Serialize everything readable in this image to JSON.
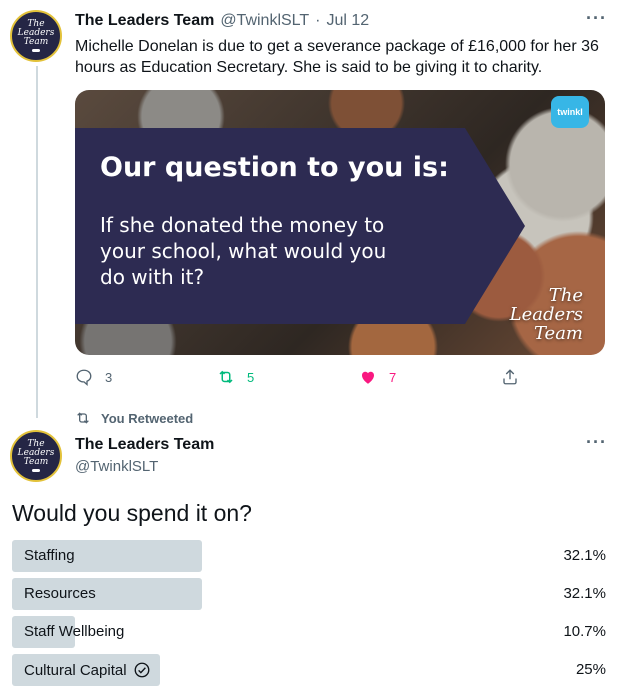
{
  "tweet": {
    "author_name": "The Leaders Team",
    "author_handle": "@TwinklSLT",
    "separator": "·",
    "date": "Jul 12",
    "avatar_text": [
      "The",
      "Leaders",
      "Team"
    ],
    "text": "Michelle Donelan is due to get a severance package of £16,000 for her 36 hours as Education Secretary. She is said to be giving it to charity.",
    "media": {
      "title": "Our question to you is:",
      "body": "If she donated the money to your school, what would you do with it?",
      "brand_badge": "twinkl",
      "watermark": [
        "The",
        "Leaders",
        "Team"
      ]
    },
    "actions": {
      "replies": "3",
      "retweets": "5",
      "likes": "7"
    },
    "colors": {
      "retweet_green": "#00ba7c",
      "like_pink": "#f91880",
      "muted": "#536471"
    }
  },
  "retweet_context": "You Retweeted",
  "poll_tweet": {
    "author_name": "The Leaders Team",
    "author_handle": "@TwinklSLT",
    "avatar_text": [
      "The",
      "Leaders",
      "Team"
    ],
    "question": "Would you spend it on?",
    "options": [
      {
        "label": "Staffing",
        "percent_text": "32.1%",
        "percent": 32.1,
        "selected": false
      },
      {
        "label": "Resources",
        "percent_text": "32.1%",
        "percent": 32.1,
        "selected": false
      },
      {
        "label": "Staff Wellbeing",
        "percent_text": "10.7%",
        "percent": 10.7,
        "selected": false
      },
      {
        "label": "Cultural Capital",
        "percent_text": "25%",
        "percent": 25,
        "selected": true
      }
    ]
  }
}
